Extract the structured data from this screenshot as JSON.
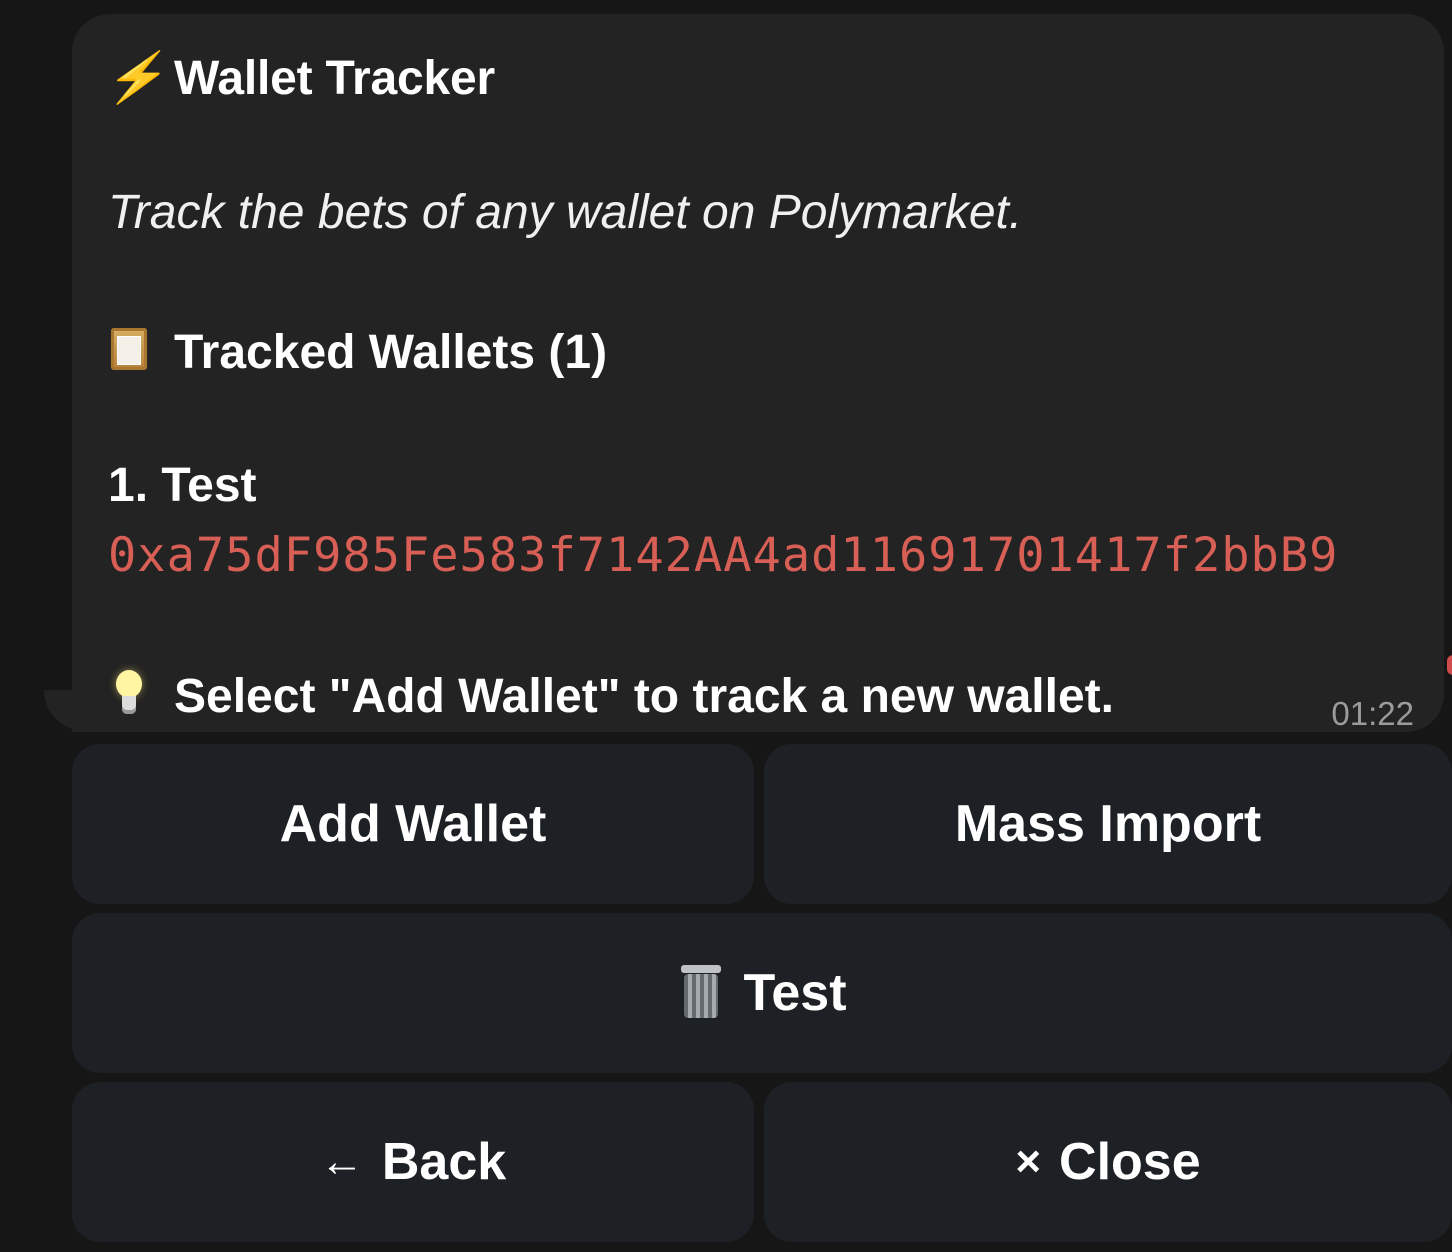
{
  "message": {
    "title_icon": "lightning-icon",
    "title": "Wallet Tracker",
    "subtitle": "Track the bets of any wallet on Polymarket.",
    "section_icon": "clipboard-icon",
    "section_title": "Tracked Wallets (1)",
    "wallets": [
      {
        "index_label": "1. Test",
        "address": "0xa75dF985Fe583f7142AA4ad11691701417f2bbB9"
      }
    ],
    "hint_icon": "lightbulb-icon",
    "hint": "Select \"Add Wallet\" to track a new wallet.",
    "time": "01:22"
  },
  "keyboard": {
    "add_wallet": "Add Wallet",
    "mass_import": "Mass Import",
    "delete_test_icon": "trash-icon",
    "delete_test": "Test",
    "back_icon": "left-arrow-icon",
    "back": "Back",
    "close_icon": "close-icon",
    "close": "Close"
  },
  "colors": {
    "background": "#161616",
    "bubble": "#232323",
    "button": "#1d2125",
    "address": "#d85f55",
    "time": "#9b9b9b"
  }
}
